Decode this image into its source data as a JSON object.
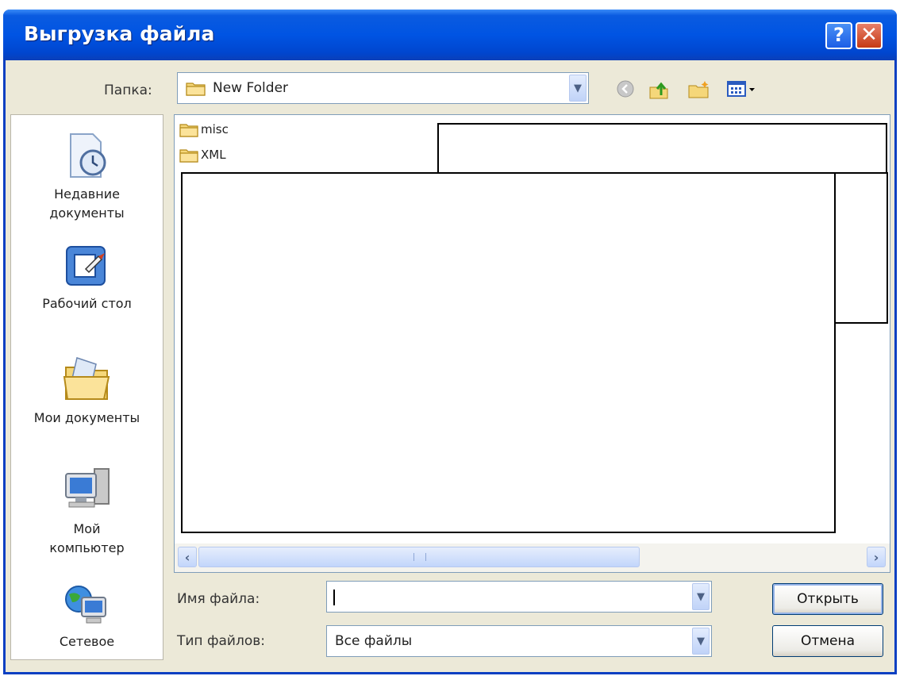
{
  "window": {
    "title": "Выгрузка файла",
    "help_label": "?",
    "close_label": "✕"
  },
  "toolbar": {
    "folder_label": "Папка:",
    "current_folder": "New Folder",
    "icons": [
      "back-icon",
      "up-folder-icon",
      "new-folder-icon",
      "view-menu-icon"
    ]
  },
  "places": [
    {
      "label": "Недавние документы",
      "icon": "recent-documents-icon"
    },
    {
      "label": "Рабочий стол",
      "icon": "desktop-icon"
    },
    {
      "label": "Мои документы",
      "icon": "my-documents-icon"
    },
    {
      "label": "Мой компьютер",
      "icon": "my-computer-icon"
    },
    {
      "label": "Сетевое",
      "icon": "network-icon"
    }
  ],
  "files": [
    {
      "name": "misc",
      "icon": "folder-icon"
    },
    {
      "name": "XML",
      "icon": "folder-icon"
    }
  ],
  "scrollbar": {
    "left_arrow": "‹",
    "right_arrow": "›"
  },
  "form": {
    "filename_label": "Имя файла:",
    "filename_value": "",
    "filetype_label": "Тип файлов:",
    "filetype_value": "Все файлы"
  },
  "buttons": {
    "open": "Открыть",
    "cancel": "Отмена"
  },
  "colors": {
    "title_bar": "#0054e3",
    "dialog_bg": "#ece9d8",
    "border": "#0a3fc2"
  }
}
